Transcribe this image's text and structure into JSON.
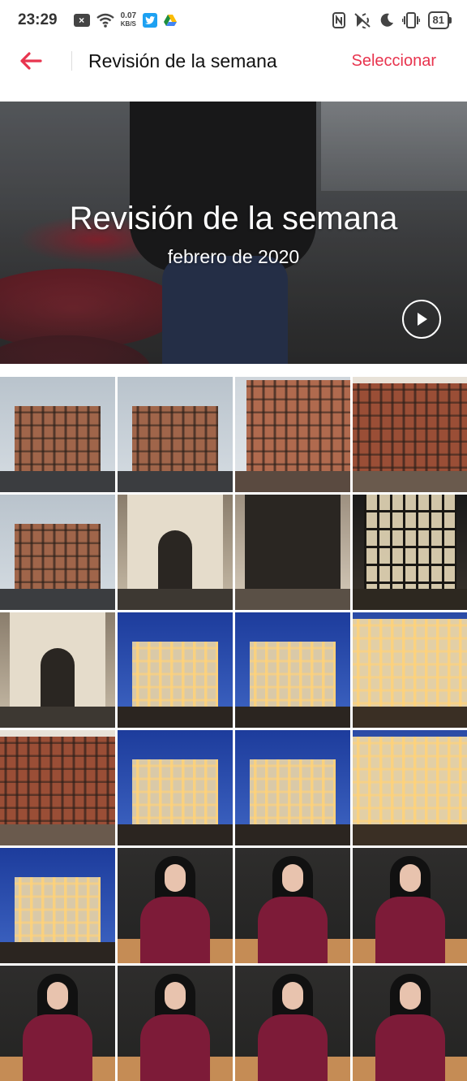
{
  "status_bar": {
    "time": "23:29",
    "netspeed_value": "0.07",
    "netspeed_unit": "KB/S",
    "battery": "81",
    "icons": [
      "notification-x-icon",
      "wifi-icon",
      "twitter-icon",
      "drive-icon",
      "nfc-icon",
      "vibrate-off-icon",
      "moon-icon",
      "vibrate-icon",
      "battery-icon"
    ]
  },
  "app_bar": {
    "title": "Revisión de la semana",
    "select_label": "Seleccionar",
    "accent_color": "#e8344e"
  },
  "hero": {
    "title": "Revisión de la semana",
    "subtitle": "febrero de 2020"
  },
  "grid": {
    "photos": [
      {
        "subject": "building-day"
      },
      {
        "subject": "building-day"
      },
      {
        "subject": "building-facade-day"
      },
      {
        "subject": "building-detail-day"
      },
      {
        "subject": "building-day"
      },
      {
        "subject": "entrance-hall"
      },
      {
        "subject": "ornate-door"
      },
      {
        "subject": "iron-gate"
      },
      {
        "subject": "entrance-hall"
      },
      {
        "subject": "building-night"
      },
      {
        "subject": "building-night"
      },
      {
        "subject": "building-night-corner"
      },
      {
        "subject": "building-detail-day"
      },
      {
        "subject": "building-night"
      },
      {
        "subject": "building-night"
      },
      {
        "subject": "building-night-corner"
      },
      {
        "subject": "building-night"
      },
      {
        "subject": "portrait"
      },
      {
        "subject": "portrait"
      },
      {
        "subject": "portrait"
      },
      {
        "subject": "portrait"
      },
      {
        "subject": "portrait"
      },
      {
        "subject": "portrait"
      },
      {
        "subject": "portrait"
      }
    ]
  }
}
